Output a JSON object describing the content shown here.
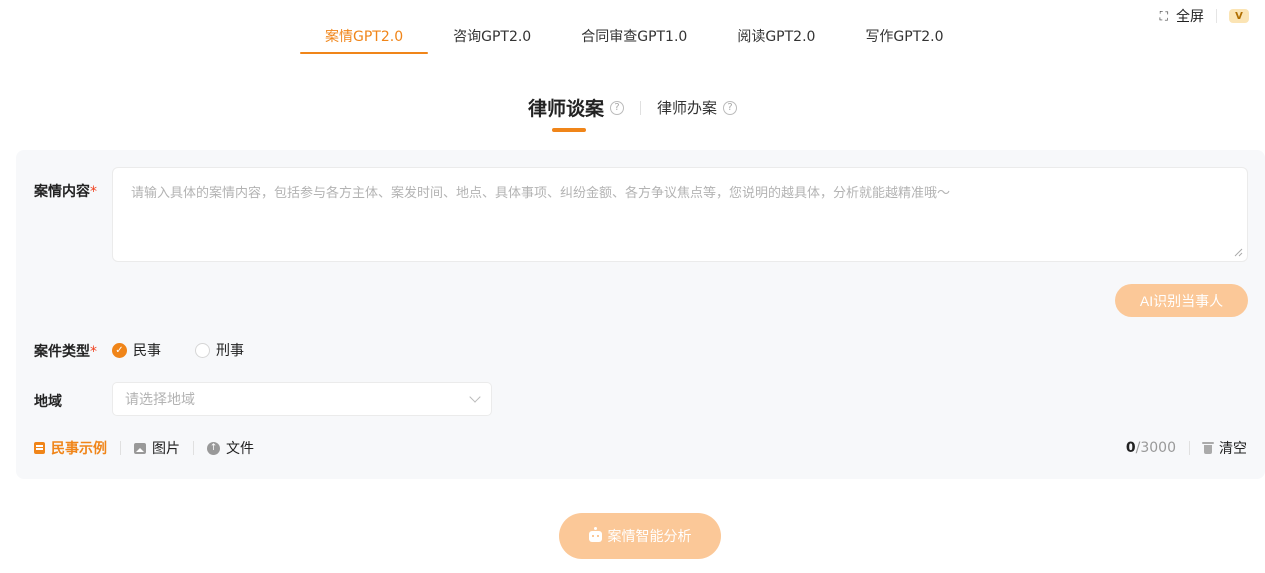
{
  "top_right": {
    "fullscreen_label": "全屏",
    "fullscreen_icon": "expand-icon",
    "vip_badge": "V"
  },
  "model_tabs": [
    {
      "label": "案情GPT2.0",
      "active": true
    },
    {
      "label": "咨询GPT2.0",
      "active": false
    },
    {
      "label": "合同审查GPT1.0",
      "active": false
    },
    {
      "label": "阅读GPT2.0",
      "active": false
    },
    {
      "label": "写作GPT2.0",
      "active": false
    }
  ],
  "mode_tabs": [
    {
      "label": "律师谈案",
      "active": true
    },
    {
      "label": "律师办案",
      "active": false
    }
  ],
  "form": {
    "content_label": "案情内容",
    "required_mark": "*",
    "content_placeholder": "请输入具体的案情内容，包括参与各方主体、案发时间、地点、具体事项、纠纷金额、各方争议焦点等，您说明的越具体，分析就能越精准哦～",
    "content_value": "",
    "ai_button": "AI识别当事人",
    "case_type_label": "案件类型",
    "case_types": [
      {
        "label": "民事",
        "checked": true
      },
      {
        "label": "刑事",
        "checked": false
      }
    ],
    "region_label": "地域",
    "region_placeholder": "请选择地域"
  },
  "tools": {
    "example": "民事示例",
    "image": "图片",
    "file": "文件",
    "count_current": "0",
    "count_max": "/3000",
    "clear": "清空"
  },
  "analyze_button": "案情智能分析",
  "colors": {
    "accent": "#f08519",
    "button_disabled": "#fbc898",
    "card_bg": "#f7f8fa",
    "required": "#f0401d"
  }
}
